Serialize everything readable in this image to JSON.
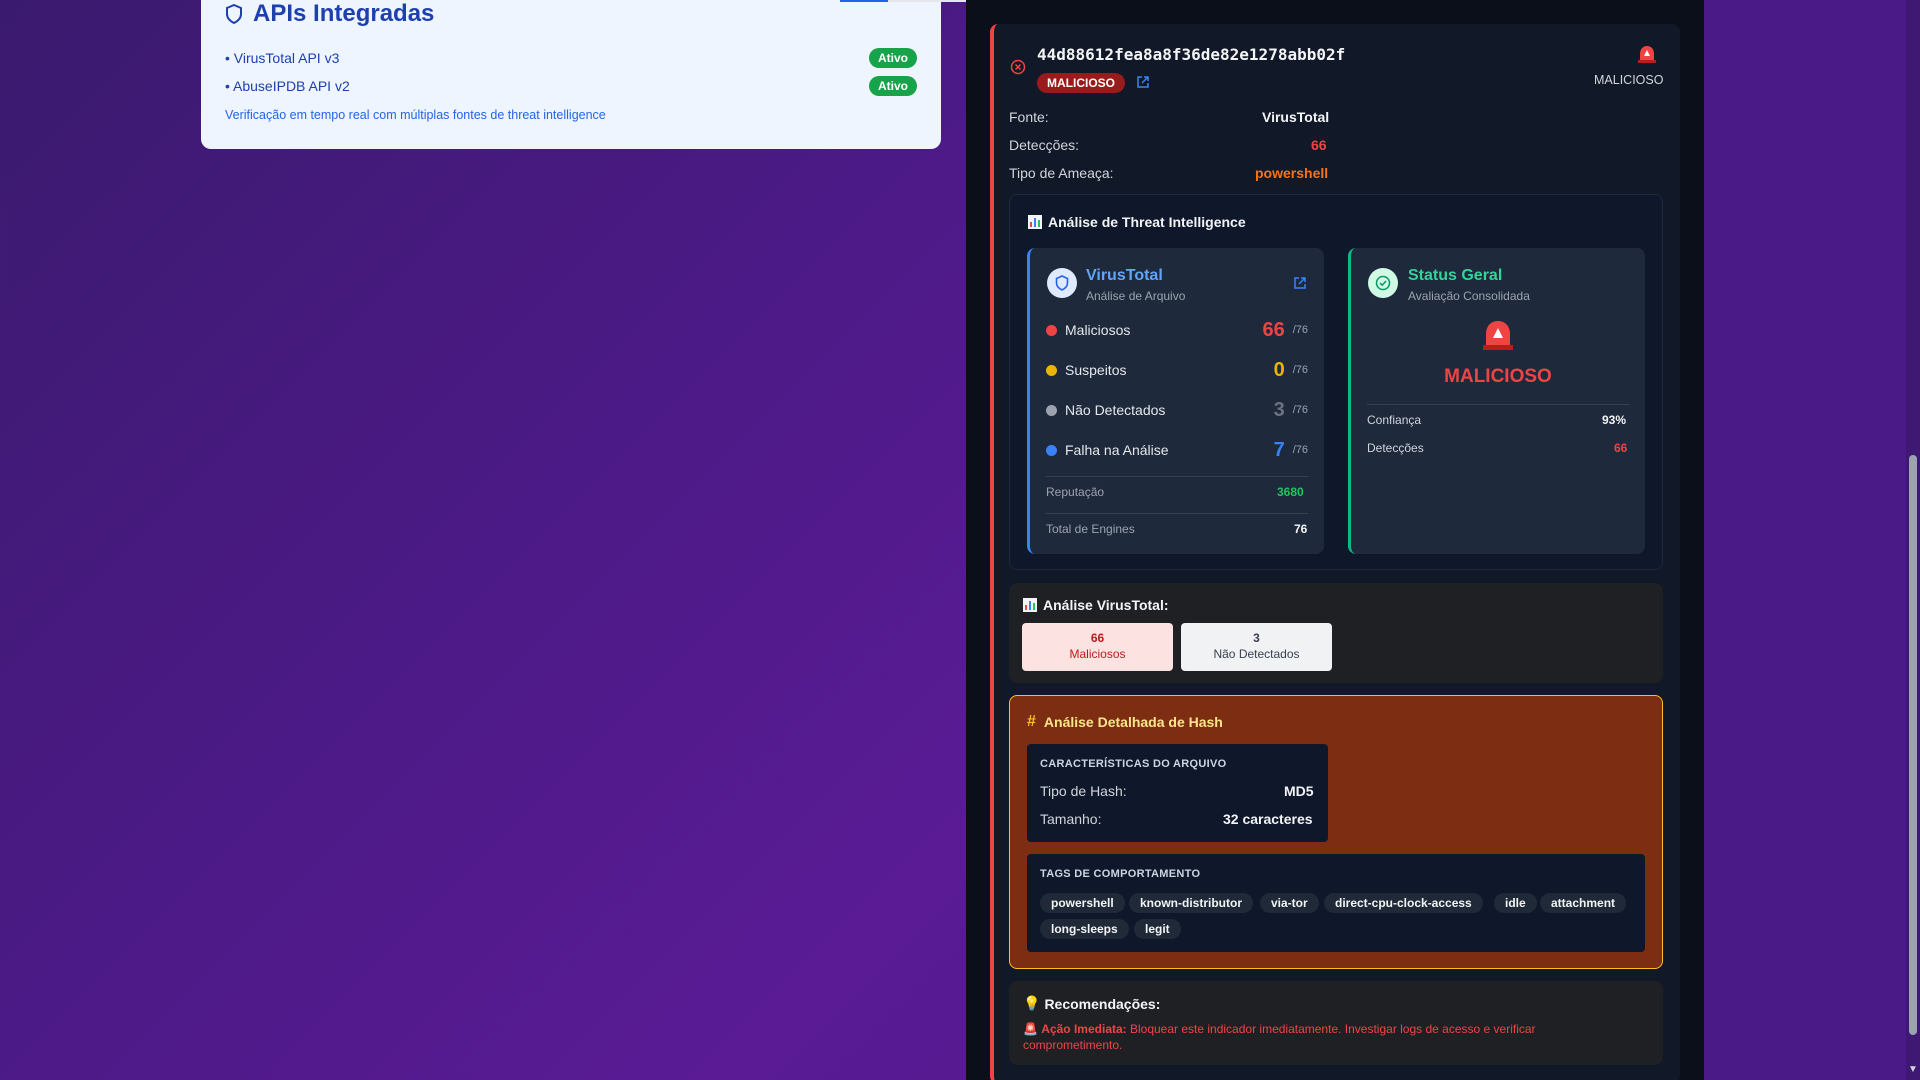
{
  "apis": {
    "title": "APIs Integradas",
    "items": [
      {
        "label": "• VirusTotal API v3",
        "status": "Ativo"
      },
      {
        "label": "• AbuseIPDB API v2",
        "status": "Ativo"
      }
    ],
    "note": "Verificação em tempo real com múltiplas fontes de threat intelligence"
  },
  "result": {
    "hash": "44d88612fea8a8f36de82e1278abb02f",
    "verdict_pill": "MALICIOSO",
    "verdict_top": "MALICIOSO",
    "fields": [
      {
        "label": "Fonte:",
        "value": "VirusTotal",
        "color": "#f3f4f6"
      },
      {
        "label": "Detecções:",
        "value": "66",
        "color": "#ef4444"
      },
      {
        "label": "Tipo de Ameaça:",
        "value": "powershell",
        "color": "#f97316"
      }
    ]
  },
  "threat_intel": {
    "title": "Análise de Threat Intelligence",
    "virustotal": {
      "name": "VirusTotal",
      "subtitle": "Análise de Arquivo",
      "stats": [
        {
          "label": "Maliciosos",
          "value": "66",
          "of": "/76",
          "color": "#ef4444"
        },
        {
          "label": "Suspeitos",
          "value": "0",
          "of": "/76",
          "color": "#eab308"
        },
        {
          "label": "Não Detectados",
          "value": "3",
          "of": "/76",
          "color": "#6b7280"
        },
        {
          "label": "Falha na Análise",
          "value": "7",
          "of": "/76",
          "color": "#3b82f6"
        }
      ],
      "reputation_label": "Reputação",
      "reputation_value": "3680",
      "engines_label": "Total de Engines",
      "engines_value": "76"
    },
    "status": {
      "name": "Status Geral",
      "subtitle": "Avaliação Consolidada",
      "verdict": "MALICIOSO",
      "confidence_label": "Confiança",
      "confidence_value": "93%",
      "detections_label": "Detecções",
      "detections_value": "66"
    }
  },
  "vt_analysis": {
    "title": "Análise VirusTotal:",
    "malicious_count": "66",
    "malicious_label": "Maliciosos",
    "undetected_count": "3",
    "undetected_label": "Não Detectados"
  },
  "hash_detail": {
    "title": "Análise Detalhada de Hash",
    "characteristics_caption": "CARACTERÍSTICAS DO ARQUIVO",
    "hash_type_label": "Tipo de Hash:",
    "hash_type_value": "MD5",
    "size_label": "Tamanho:",
    "size_value": "32 caracteres",
    "tags_caption": "TAGS DE COMPORTAMENTO",
    "tags": [
      "powershell",
      "known-distributor",
      "via-tor",
      "direct-cpu-clock-access",
      "idle",
      "attachment",
      "long-sleeps",
      "legit"
    ]
  },
  "recommendations": {
    "title": "Recomendações:",
    "action_label": "Ação Imediata:",
    "action_text": " Bloquear este indicador imediatamente. Investigar logs de acesso e verificar comprometimento."
  }
}
